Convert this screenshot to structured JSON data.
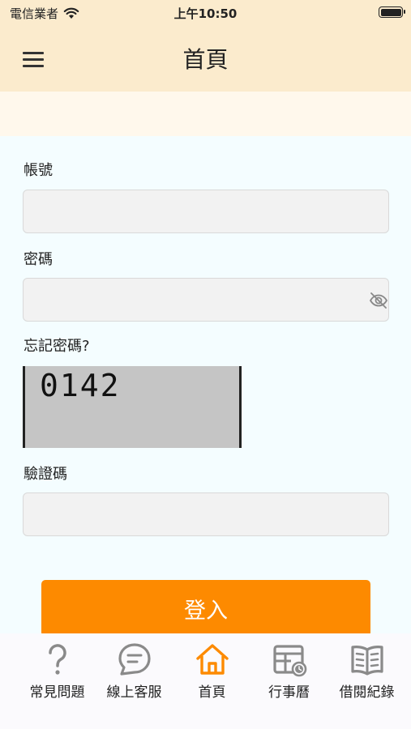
{
  "status_bar": {
    "carrier": "電信業者",
    "time": "上午10:50"
  },
  "header": {
    "title": "首頁"
  },
  "form": {
    "account_label": "帳號",
    "account_value": "",
    "password_label": "密碼",
    "password_value": "",
    "forgot_password": "忘記密碼?",
    "captcha_text": "0142",
    "verification_label": "驗證碼",
    "verification_value": "",
    "login_button": "登入"
  },
  "tabs": [
    {
      "label": "常見問題",
      "icon": "question-icon",
      "active": false
    },
    {
      "label": "線上客服",
      "icon": "chat-icon",
      "active": false
    },
    {
      "label": "首頁",
      "icon": "home-icon",
      "active": true
    },
    {
      "label": "行事曆",
      "icon": "calendar-icon",
      "active": false
    },
    {
      "label": "借閱紀錄",
      "icon": "book-icon",
      "active": false
    }
  ],
  "colors": {
    "header_bg": "#fbebcd",
    "accent": "#fd8a00",
    "page_bg": "#f4fdff",
    "icon_gray": "#8a8a8a"
  }
}
